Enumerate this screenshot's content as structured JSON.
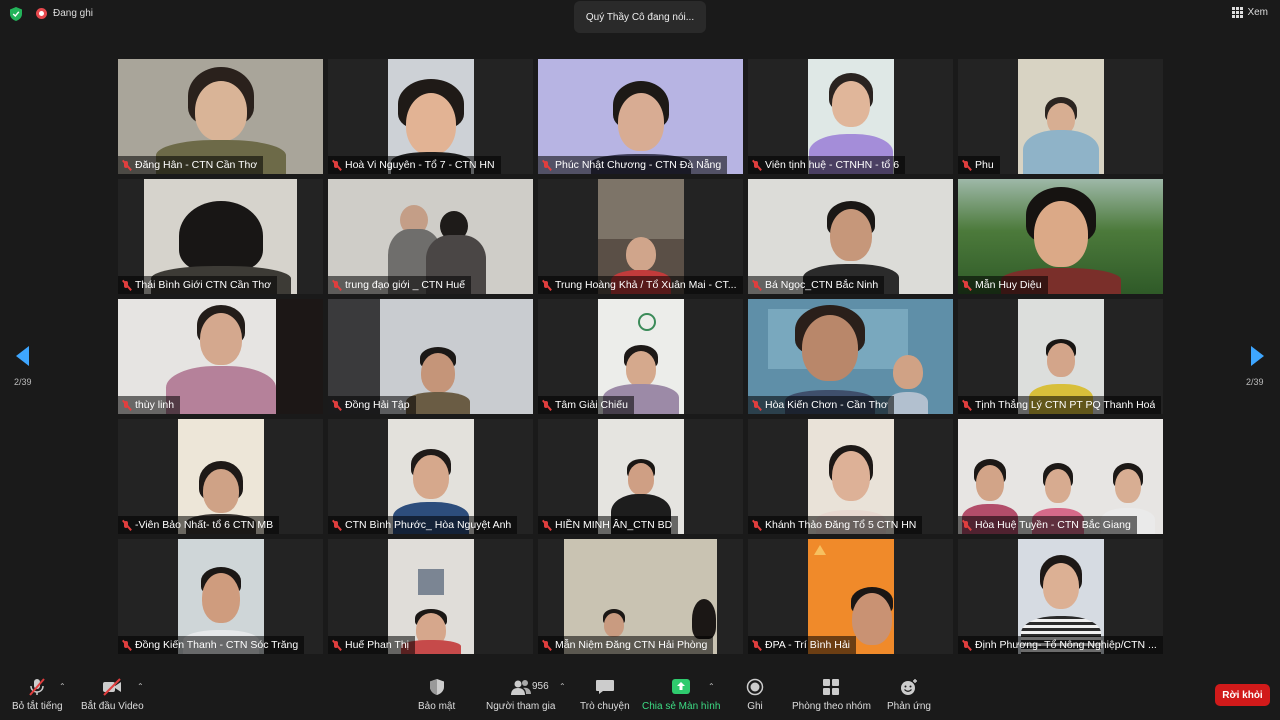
{
  "topbar": {
    "recording_label": "Đang ghi",
    "speaker_label": "Quý Thầy Cô đang nói...",
    "view_label": "Xem"
  },
  "pagination": {
    "left_label": "2/39",
    "right_label": "2/39"
  },
  "participants": [
    {
      "name": "Đăng Hân - CTN Cần Thơ"
    },
    {
      "name": "Hoà Vi Nguyên -  Tổ 7 - CTN HN"
    },
    {
      "name": "Phúc Nhật Chương - CTN Đà Nẵng"
    },
    {
      "name": "Viên tịnh huệ - CTNHN - tổ 6"
    },
    {
      "name": "Phu"
    },
    {
      "name": "Thái Bình Giới CTN Cần Thơ"
    },
    {
      "name": "trung đạo giới _ CTN Huế"
    },
    {
      "name": "Trung Hoàng Khả / Tổ Xuân Mai - CT..."
    },
    {
      "name": "Bá Ngọc_CTN Bắc Ninh"
    },
    {
      "name": "Mẫn Huy Diệu"
    },
    {
      "name": "thùy linh"
    },
    {
      "name": "Đồng Hải Tập"
    },
    {
      "name": "Tâm Giải Chiếu"
    },
    {
      "name": "Hòa Kiến Chơn - Cần Thơ"
    },
    {
      "name": "Tịnh Thắng Lý CTN PT  PQ Thanh Hoá"
    },
    {
      "name": "-Viên Bảo Nhất- tổ 6 CTN MB"
    },
    {
      "name": "CTN Bình Phước_ Hòa Nguyệt Anh"
    },
    {
      "name": "HIỀN MINH ÂN_CTN BD"
    },
    {
      "name": "Khánh Thảo Đăng Tổ 5 CTN HN"
    },
    {
      "name": "Hòa Huệ Tuyền - CTN Bắc Giang"
    },
    {
      "name": "Đồng Kiến Thanh - CTN Sóc Trăng"
    },
    {
      "name": "Huế Phan Thị"
    },
    {
      "name": "Mẫn Niệm Đăng CTN Hải Phòng"
    },
    {
      "name": "ĐPA - Trí Bình Hải"
    },
    {
      "name": "Định Phương- Tổ Nông Nghiệp/CTN ..."
    }
  ],
  "toolbar": {
    "mute_label": "Bỏ tắt tiếng",
    "video_label": "Bắt đầu Video",
    "security_label": "Bảo mật",
    "participants_label": "Người tham gia",
    "participants_count": "956",
    "chat_label": "Trò chuyện",
    "share_label": "Chia sẻ Màn hình",
    "record_label": "Ghi",
    "breakout_label": "Phòng theo nhóm",
    "reactions_label": "Phản ứng",
    "leave_label": "Rời khỏi"
  },
  "colors": {
    "accent_blue": "#3ea6ff",
    "share_green": "#3ddc84",
    "leave_red": "#d11a1a",
    "muted_red": "#e03e3e"
  }
}
